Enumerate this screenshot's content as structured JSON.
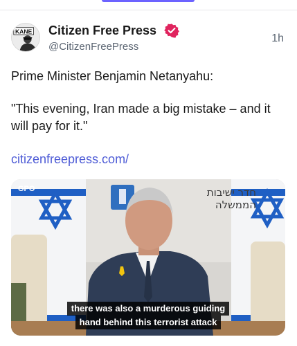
{
  "post": {
    "display_name": "Citizen Free Press",
    "handle": "@CitizenFreePress",
    "time": "1h",
    "avatar_text": "KANE",
    "body_line1": "Prime Minister Benjamin Netanyahu:",
    "body_quote": "\"This evening, Iran made a big mistake – and it will pay for it.\"",
    "link": "citizenfreepress.com/"
  },
  "media": {
    "logo_text": "GPO",
    "sign_line1": "חדר ישיבות",
    "sign_line2": "הממשלה",
    "caption_line1": "there was also a murderous guiding",
    "caption_line2": "hand behind this terrorist attack"
  },
  "colors": {
    "accent": "#6c63ff",
    "verified": "#e0245e",
    "link": "#4d5bd6",
    "flag_blue": "#1f5fc4"
  },
  "icons": {
    "verified": "verified-badge-icon",
    "avatar": "kane-avatar"
  }
}
